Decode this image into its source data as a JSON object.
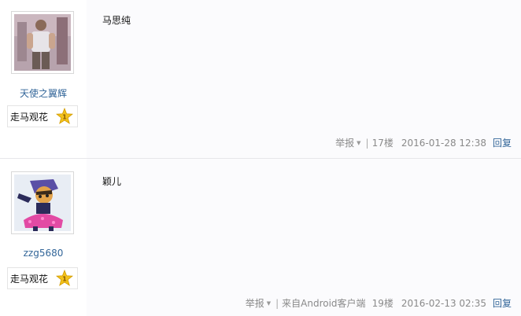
{
  "posts": [
    {
      "username": "天使之翼辉",
      "rank_label": "走马观花",
      "rank_level": "1",
      "text": "马思纯",
      "footer": {
        "report": "举报",
        "source_prefix": "",
        "source_app": "",
        "floor": "17楼",
        "time": "2016-01-28 12:38",
        "reply": "回复"
      }
    },
    {
      "username": "zzg5680",
      "rank_label": "走马观花",
      "rank_level": "1",
      "text": "颖儿",
      "footer": {
        "report": "举报",
        "source_prefix": "来自",
        "source_app": "Android客户端",
        "floor": "19楼",
        "time": "2016-02-13 02:35",
        "reply": "回复"
      }
    }
  ],
  "colors": {
    "link": "#336699",
    "meta": "#8a8a8a",
    "content_bg": "#fbfbfd",
    "star": "#f3c21a"
  }
}
